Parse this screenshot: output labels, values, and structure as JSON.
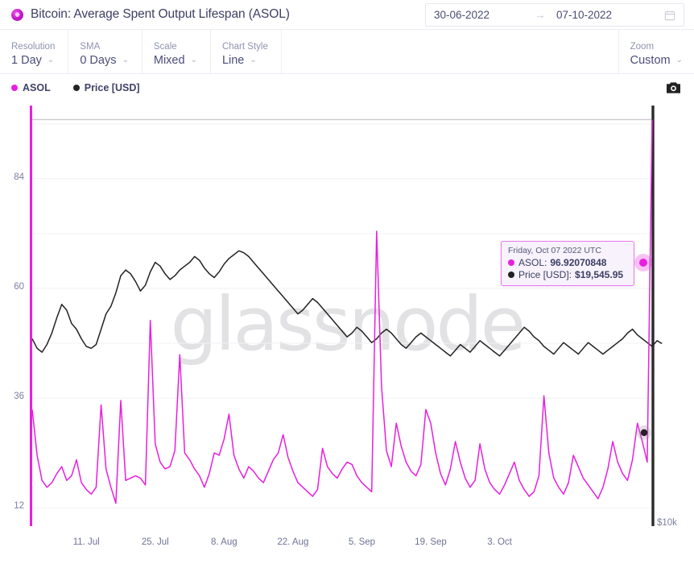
{
  "header": {
    "logo_glyph": "◉",
    "title": "Bitcoin: Average Spent Output Lifespan (ASOL)",
    "date_range": {
      "start": "30-06-2022",
      "arrow": "→",
      "end": "07-10-2022",
      "calendar_icon": "calendar-icon"
    }
  },
  "toolbar": {
    "controls": [
      {
        "label": "Resolution",
        "value": "1 Day",
        "caret": "⌄"
      },
      {
        "label": "SMA",
        "value": "0 Days",
        "caret": "⌄"
      },
      {
        "label": "Scale",
        "value": "Mixed",
        "caret": "⌄"
      },
      {
        "label": "Chart Style",
        "value": "Line",
        "caret": "⌄"
      }
    ],
    "zoom": {
      "label": "Zoom",
      "value": "Custom",
      "caret": "⌄"
    }
  },
  "legend": {
    "items": [
      {
        "label": "ASOL",
        "color": "#e81fe0"
      },
      {
        "label": "Price [USD]",
        "color": "#232323"
      }
    ],
    "camera_icon": "camera-icon"
  },
  "tooltip": {
    "date": "Friday, Oct 07 2022 UTC",
    "rows": [
      {
        "dot_color": "#e81fe0",
        "name": "ASOL:",
        "value": "96.92070848"
      },
      {
        "dot_color": "#232323",
        "name": "Price [USD]:",
        "value": "$19,545.95"
      }
    ]
  },
  "colors": {
    "asol": "#e81fe0",
    "price": "#232323",
    "grid": "#f2f2f6",
    "crosshair": "#c9c9cf",
    "watermark": "#e2e2e4",
    "text": "#4b4f7a"
  },
  "watermark_text": "glassnode",
  "chart_data": {
    "type": "line",
    "title": "Bitcoin: Average Spent Output Lifespan (ASOL)",
    "xlabel": "",
    "ylabel": "ASOL",
    "y2label": "Price [USD]",
    "grid": true,
    "legend_position": "top-left",
    "scale": "Mixed",
    "resolution": "1 Day",
    "x_ticks": [
      "11. Jul",
      "25. Jul",
      "8. Aug",
      "22. Aug",
      "5. Sep",
      "19. Sep",
      "3. Oct"
    ],
    "y_ticks": [
      84,
      60,
      36,
      12
    ],
    "ylim": [
      8,
      100
    ],
    "y2_ticks": [
      "$10k"
    ],
    "y2lim": [
      10000,
      32000
    ],
    "x_range": [
      "30-06-2022",
      "07-10-2022"
    ],
    "highlight": {
      "date": "Friday, Oct 07 2022 UTC",
      "asol": 96.92070848,
      "price": 19545.95
    },
    "series": [
      {
        "name": "ASOL",
        "color": "#e81fe0",
        "axis": "left",
        "values": [
          33.5,
          23.5,
          18.0,
          16.5,
          17.5,
          19.5,
          21.0,
          18.0,
          19.0,
          22.5,
          17.5,
          16.0,
          15.0,
          16.5,
          34.5,
          20.5,
          16.5,
          13.0,
          35.5,
          18.0,
          18.5,
          19.0,
          18.5,
          17.0,
          53.0,
          26.0,
          22.0,
          20.5,
          21.0,
          24.5,
          45.5,
          24.0,
          22.5,
          20.5,
          19.0,
          16.5,
          19.5,
          24.0,
          23.5,
          27.0,
          32.5,
          23.5,
          20.5,
          18.5,
          21.0,
          20.0,
          18.5,
          17.5,
          20.0,
          22.5,
          24.0,
          28.0,
          23.0,
          20.0,
          17.5,
          16.5,
          15.5,
          14.5,
          16.0,
          25.0,
          21.0,
          19.5,
          18.5,
          20.5,
          22.0,
          21.5,
          19.0,
          17.5,
          16.5,
          15.5,
          72.5,
          38.5,
          24.5,
          21.0,
          30.5,
          25.5,
          22.0,
          20.0,
          19.0,
          21.5,
          33.5,
          30.5,
          24.0,
          19.5,
          17.0,
          20.5,
          26.5,
          22.0,
          18.5,
          16.5,
          18.0,
          26.0,
          20.5,
          17.5,
          16.0,
          15.0,
          17.0,
          19.5,
          22.0,
          18.0,
          16.0,
          14.5,
          15.5,
          19.0,
          36.5,
          24.0,
          18.5,
          16.5,
          15.0,
          17.5,
          23.5,
          21.0,
          18.5,
          17.0,
          15.5,
          14.0,
          16.5,
          20.5,
          26.5,
          22.0,
          19.5,
          18.0,
          22.5,
          30.5,
          26.5,
          22.0,
          96.92
        ]
      },
      {
        "name": "Price [USD]",
        "color": "#232323",
        "axis": "right",
        "values": [
          19800,
          19300,
          19100,
          19500,
          20100,
          20900,
          21600,
          21300,
          20600,
          20300,
          19800,
          19400,
          19300,
          19500,
          20300,
          21100,
          21500,
          22200,
          23100,
          23400,
          23200,
          22800,
          22300,
          22600,
          23300,
          23800,
          23600,
          23200,
          22900,
          23100,
          23400,
          23600,
          23800,
          24100,
          23900,
          23500,
          23200,
          23000,
          23300,
          23700,
          24000,
          24200,
          24400,
          24300,
          24100,
          23800,
          23500,
          23200,
          22900,
          22600,
          22300,
          22000,
          21700,
          21400,
          21100,
          21300,
          21600,
          21900,
          21700,
          21400,
          21100,
          20800,
          20500,
          20200,
          19900,
          20100,
          20400,
          20200,
          19900,
          19600,
          19800,
          20100,
          20300,
          20100,
          19800,
          19500,
          19300,
          19600,
          19900,
          20100,
          19900,
          19700,
          19500,
          19300,
          19100,
          18900,
          19200,
          19500,
          19300,
          19100,
          19400,
          19700,
          19500,
          19300,
          19100,
          18900,
          19200,
          19500,
          19800,
          20100,
          20400,
          20200,
          19900,
          19700,
          19400,
          19200,
          19000,
          19300,
          19600,
          19400,
          19200,
          19000,
          19300,
          19600,
          19400,
          19200,
          19000,
          19200,
          19400,
          19600,
          19800,
          20100,
          20300,
          20000,
          19800,
          19600,
          19400,
          19700,
          19545.95
        ]
      }
    ]
  }
}
